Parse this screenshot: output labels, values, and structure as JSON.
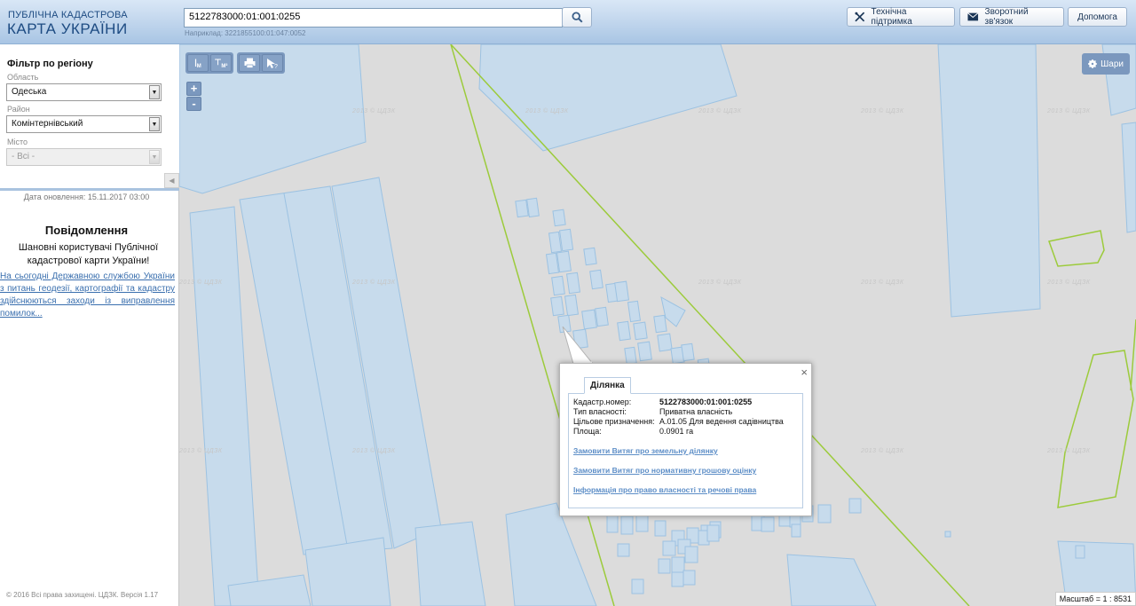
{
  "header": {
    "logo_line1": "ПУБЛІЧНА КАДАСТРОВА",
    "logo_line2": "КАРТА УКРАЇНИ",
    "search_value": "5122783000:01:001:0255",
    "search_hint": "Наприклад: 3221855100:01:047:0052",
    "buttons": {
      "support": "Технічна підтримка",
      "feedback": "Зворотний зв'язок",
      "help": "Допомога"
    }
  },
  "sidebar": {
    "filter_title": "Фільтр по регіону",
    "region_label": "Область",
    "region_value": "Одеська",
    "district_label": "Район",
    "district_value": "Комінтернівський",
    "city_label": "Місто",
    "city_value": "- Всі -",
    "update_date": "Дата оновлення: 15.11.2017 03:00",
    "notice_title": "Повідомлення",
    "notice_text": "Шановні користувачі Публічної кадастрової карти України!",
    "notice_link": "На сьогодні Державною службою України з питань геодезії, картографії та кадастру здійснюються заходи із виправлення помилок...",
    "copyright": "© 2016 Всі права захищені. ЦДЗК. Версія 1.17"
  },
  "map": {
    "layers_label": "Шари",
    "tools": {
      "measure_m": "M",
      "measure_m2": "M²"
    },
    "zoom_in": "+",
    "zoom_out": "-",
    "watermark": "2013 © ЦДЗК",
    "scale": "Масштаб = 1 : 8531"
  },
  "popup": {
    "tab": "Ділянка",
    "rows": [
      {
        "key": "Кадастр.номер:",
        "value": "5122783000:01:001:0255"
      },
      {
        "key": "Тип власності:",
        "value": "Приватна власність"
      },
      {
        "key": "Цільове призначення:",
        "value": "А.01.05 Для ведення садівництва"
      },
      {
        "key": "Площа:",
        "value": "0.0901 га"
      }
    ],
    "links": [
      "Замовити Витяг про земельну ділянку",
      "Замовити Витяг про нормативну грошову оцінку",
      "Інформація про право власності та речові права"
    ],
    "close": "×"
  },
  "colors": {
    "parcel_fill": "#c7dbec",
    "parcel_stroke": "#9cc2e2",
    "boundary_green": "#9ccb3b",
    "map_bg": "#dcdcdc",
    "header_top": "#d9e7f6",
    "header_bottom": "#a9c5e4",
    "link_blue": "#5d8ec7"
  }
}
